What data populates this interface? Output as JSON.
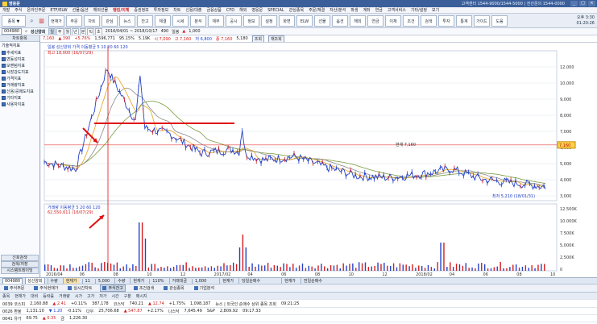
{
  "titlebar": {
    "title": "영웅문",
    "info": "고객센터 1544-9000/1544-5000 | 전산문의 1544-0000",
    "controls": [
      "_",
      "□",
      "×"
    ]
  },
  "menu": [
    "개발",
    "주식",
    "온라인주문",
    "ETF/ELW",
    "선물/옵션",
    "해외선물",
    "뱅킹/이체",
    "증권정보",
    "투자정보",
    "차트",
    "신용/대출",
    "금융상품",
    "CFD",
    "해외",
    "영웅문",
    "SPECIAL",
    "관심종목",
    "주문/체결",
    "자산/분석",
    "파생",
    "계좌",
    "연금",
    "고객서비스",
    "기타/설정",
    "보기"
  ],
  "menu_hot_index": 6,
  "iconbar": {
    "search_label": "종목 ▼",
    "buttons": [
      "현재가",
      "주문",
      "차트",
      "관심",
      "뉴스",
      "잔고",
      "체결",
      "시세",
      "분석",
      "재무",
      "공시",
      "정보",
      "설정",
      "화면",
      "ELW",
      "선물",
      "옵션",
      "해외",
      "연금",
      "이체",
      "조건",
      "검색",
      "투자",
      "통계",
      "가이드",
      "도움"
    ],
    "right_times": [
      "오후 3:30",
      "01:20:26"
    ]
  },
  "stockrow": {
    "code": "004980",
    "name": "성신양회",
    "fields": [
      "일",
      "주",
      "월",
      "년",
      "분",
      "틱",
      "초"
    ],
    "period": "2016/04/01 ~ 2018/10/17",
    "count": "490",
    "unit": "일봉",
    "value_display": "1,000",
    "up": "▲"
  },
  "pricerow": {
    "price": "7,160",
    "change": "▲ 390",
    "rate": "+5.76%",
    "volume": "1,596,771",
    "ratio": "95.15%",
    "high": "5.19K",
    "t1": "시 7,090",
    "t2": "고 7,160",
    "t3": "저 6,800",
    "t4": "종 7,160",
    "t5": "5,180",
    "btn1": "조회",
    "btn2": "재조회"
  },
  "sidebar": {
    "header": "차트항목",
    "category": "기술적지표",
    "items": [
      "추세지표",
      "변동성지표",
      "모멘텀지표",
      "시장강도지표",
      "가격지표",
      "거래량지표",
      "신용/공매도지표",
      "기타지표",
      "사용자지표"
    ],
    "buttons": [
      "신호검색",
      "검색/저장",
      "시스템트레이딩",
      "나의 차트지표"
    ]
  },
  "chart": {
    "legend_price": "일봉 성신양회 가격 이동평균 5 10 20 60 120",
    "legend_high": "최고 18,000 (16/07/29)",
    "legend_low": "최저 5,210 (18/01/31)",
    "legend_volume": "거래량 이동평균 5 20 60 120",
    "legend_vol_max": "62,550,611 (16/07/29)",
    "marker_label": "현재 7,160",
    "y_axis": [
      "12,000",
      "10,000",
      "9,000",
      "8,000",
      "7,000",
      "6,000",
      "5,000",
      "4,000",
      "3,000"
    ],
    "price_tag": "7,160",
    "vol_axis": [
      "12.500K",
      "10.000K",
      "7.500K",
      "5,000K",
      "2,500K",
      "0"
    ],
    "x_axis": [
      "2016/04",
      "06",
      "08",
      "10",
      "12",
      "2017/02",
      "04",
      "06",
      "08",
      "10",
      "12",
      "2018/02",
      "04",
      "06",
      "08",
      "10"
    ],
    "hline_color": "#e01010",
    "arrow_color": "#e01010"
  },
  "chart_data": {
    "type": "line",
    "title": "",
    "xlabel": "",
    "ylabel": "",
    "ylim": [
      4000,
      12500
    ],
    "x": [
      "2016-04",
      "2016-06",
      "2016-07",
      "2016-08",
      "2016-10",
      "2016-12",
      "2017-02",
      "2017-04",
      "2017-06",
      "2017-08",
      "2017-10",
      "2017-12",
      "2018-02",
      "2018-04",
      "2018-06",
      "2018-08",
      "2018-10"
    ],
    "series": [
      {
        "values": [
          6200,
          5800,
          11500,
          8200,
          7800,
          6700,
          6900,
          6300,
          6500,
          5900,
          5400,
          5300,
          5500,
          5800,
          5200,
          5000,
          4800
        ]
      }
    ]
  },
  "tabsrow": {
    "code": "004980",
    "name": "성신양회",
    "segments": [
      "수량",
      "현재가",
      "11",
      "5,000",
      "수량",
      "현재가",
      "110%",
      "거래대금",
      "1,000",
      "",
      "현재가",
      "당일순매수",
      "",
      "",
      "현재가",
      "전일순매수"
    ],
    "highlight_index": 1
  },
  "taskbar": [
    "주식주문",
    "주식현재가",
    "실시간차트",
    "주식잔고",
    "조건검색",
    "관심종목",
    "기업분석"
  ],
  "ticker": {
    "head": [
      "종목",
      "현재가",
      "대비",
      "등락률",
      "거래량",
      "시가",
      "고가",
      "저가",
      "시간",
      "구분",
      "메시지",
      "",
      "",
      "",
      "",
      "",
      "",
      ""
    ],
    "rows": [
      [
        "0039 코스피",
        "2,160.88",
        "▲ 2.41",
        "+0.11%",
        "387,178",
        "코스닥",
        "740.21",
        "▲ 12.74",
        "+1.75%",
        "1,098,187",
        "뉴스 | 외국인 순매수 상위 종목 조회",
        "",
        "",
        "",
        "",
        "",
        "09:21:25",
        ""
      ],
      [
        "0026 환율",
        "1,131.10",
        "▼ 1.20",
        "-0.11%",
        "",
        "다우",
        "25,706.68",
        "▲ 547.87",
        "+2.17%",
        "나스닥",
        "7,645.49",
        "S&P",
        "2,809.92",
        "",
        "",
        "",
        "09:17:33",
        ""
      ],
      [
        "0041 유가",
        "69.75",
        "▲ 0.35",
        "",
        "",
        "금",
        "1,226.30",
        "",
        "",
        "",
        "",
        "",
        "",
        "",
        "",
        "",
        "",
        ""
      ]
    ]
  }
}
